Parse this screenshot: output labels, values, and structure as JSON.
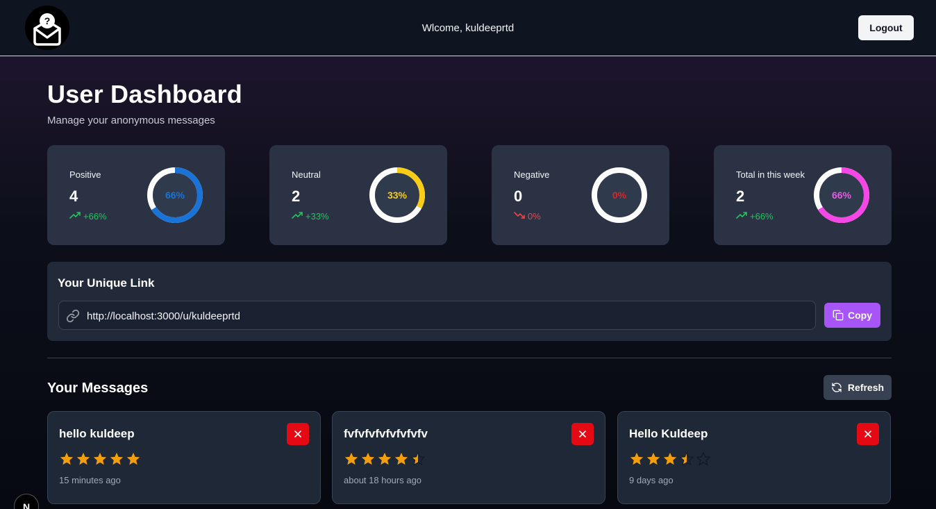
{
  "navbar": {
    "welcome": "Wlcome, kuldeeprtd",
    "logout_label": "Logout"
  },
  "header": {
    "title": "User Dashboard",
    "subtitle": "Manage your anonymous messages"
  },
  "stats": [
    {
      "label": "Positive",
      "value": "4",
      "change": "+66%",
      "trend": "up",
      "percent_label": "66%",
      "percent": 66,
      "ring_color": "#1a74d8",
      "text_color": "#1a74d8",
      "change_color": "#22c55e"
    },
    {
      "label": "Neutral",
      "value": "2",
      "change": "+33%",
      "trend": "up",
      "percent_label": "33%",
      "percent": 33,
      "ring_color": "#facc15",
      "text_color": "#facc15",
      "change_color": "#22c55e"
    },
    {
      "label": "Negative",
      "value": "0",
      "change": "0%",
      "trend": "down",
      "percent_label": "0%",
      "percent": 0,
      "ring_color": "#ef4444",
      "text_color": "#dc2626",
      "change_color": "#ef4444"
    },
    {
      "label": "Total in this week",
      "value": "2",
      "change": "+66%",
      "trend": "up",
      "percent_label": "66%",
      "percent": 66,
      "ring_color": "#f547e5",
      "text_color": "#e45de0",
      "change_color": "#22c55e"
    }
  ],
  "link_section": {
    "title": "Your Unique Link",
    "url": "http://localhost:3000/u/kuldeeprtd",
    "copy_label": "Copy"
  },
  "messages_section": {
    "title": "Your Messages",
    "refresh_label": "Refresh"
  },
  "messages": [
    {
      "text": "hello kuldeep",
      "rating": 5,
      "time": "15 minutes ago"
    },
    {
      "text": "fvfvfvfvfvfvfvfv",
      "rating": 4.5,
      "time": "about 18 hours ago"
    },
    {
      "text": "Hello Kuldeep",
      "rating": 3.5,
      "time": "9 days ago"
    }
  ],
  "dev_badge": "N",
  "colors": {
    "accent": "#a855f7",
    "danger": "#e50914",
    "star": "#f59e0b"
  }
}
